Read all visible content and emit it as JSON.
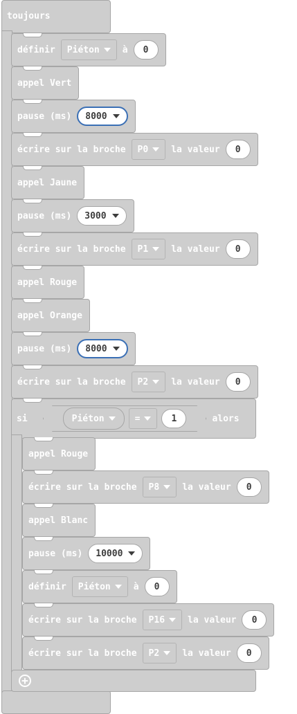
{
  "forever_label": "toujours",
  "blocks": [
    {
      "id": "b1",
      "parts": [
        {
          "t": "définir"
        },
        {
          "dd": "Piéton"
        },
        {
          "t": "à"
        },
        {
          "pill": "0"
        }
      ]
    },
    {
      "id": "b2",
      "parts": [
        {
          "t": "appel Vert"
        }
      ]
    },
    {
      "id": "b3",
      "parts": [
        {
          "t": "pause (ms)"
        },
        {
          "pilldd": "8000",
          "sel": true
        }
      ]
    },
    {
      "id": "b4",
      "parts": [
        {
          "t": "écrire sur la broche"
        },
        {
          "dd": "P0"
        },
        {
          "t": "la valeur"
        },
        {
          "pill": "0"
        }
      ]
    },
    {
      "id": "b5",
      "parts": [
        {
          "t": "appel Jaune"
        }
      ]
    },
    {
      "id": "b6",
      "parts": [
        {
          "t": "pause (ms)"
        },
        {
          "pilldd": "3000"
        }
      ]
    },
    {
      "id": "b7",
      "parts": [
        {
          "t": "écrire sur la broche"
        },
        {
          "dd": "P1"
        },
        {
          "t": "la valeur"
        },
        {
          "pill": "0"
        }
      ]
    },
    {
      "id": "b8",
      "parts": [
        {
          "t": "appel Rouge"
        }
      ]
    },
    {
      "id": "b9",
      "parts": [
        {
          "t": "appel Orange"
        }
      ]
    },
    {
      "id": "b10",
      "parts": [
        {
          "t": "pause (ms)"
        },
        {
          "pilldd": "8000",
          "sel": true
        }
      ]
    },
    {
      "id": "b11",
      "parts": [
        {
          "t": "écrire sur la broche"
        },
        {
          "dd": "P2"
        },
        {
          "t": "la valeur"
        },
        {
          "pill": "0"
        }
      ]
    }
  ],
  "if_block": {
    "si_label": "si",
    "var": "Piéton",
    "op": "=",
    "value": "1",
    "alors_label": "alors"
  },
  "inner_blocks": [
    {
      "id": "i1",
      "parts": [
        {
          "t": "appel Rouge"
        }
      ]
    },
    {
      "id": "i2",
      "parts": [
        {
          "t": "écrire sur la broche"
        },
        {
          "dd": "P8"
        },
        {
          "t": "la valeur"
        },
        {
          "pill": "0"
        }
      ]
    },
    {
      "id": "i3",
      "parts": [
        {
          "t": "appel Blanc"
        }
      ]
    },
    {
      "id": "i4",
      "parts": [
        {
          "t": "pause (ms)"
        },
        {
          "pilldd": "10000"
        }
      ]
    },
    {
      "id": "i5",
      "parts": [
        {
          "t": "définir"
        },
        {
          "dd": "Piéton"
        },
        {
          "t": "à"
        },
        {
          "pill": "0"
        }
      ]
    },
    {
      "id": "i6",
      "parts": [
        {
          "t": "écrire sur la broche"
        },
        {
          "dd": "P16"
        },
        {
          "t": "la valeur"
        },
        {
          "pill": "0"
        }
      ]
    },
    {
      "id": "i7",
      "parts": [
        {
          "t": "écrire sur la broche"
        },
        {
          "dd": "P2"
        },
        {
          "t": "la valeur"
        },
        {
          "pill": "0"
        }
      ]
    }
  ],
  "colors": {
    "block": "#cecece",
    "border": "#a6a6a6",
    "selected": "#3a6fb5"
  },
  "icons": {
    "add": "plus-circle-icon",
    "dropdown": "triangle-down-icon"
  }
}
